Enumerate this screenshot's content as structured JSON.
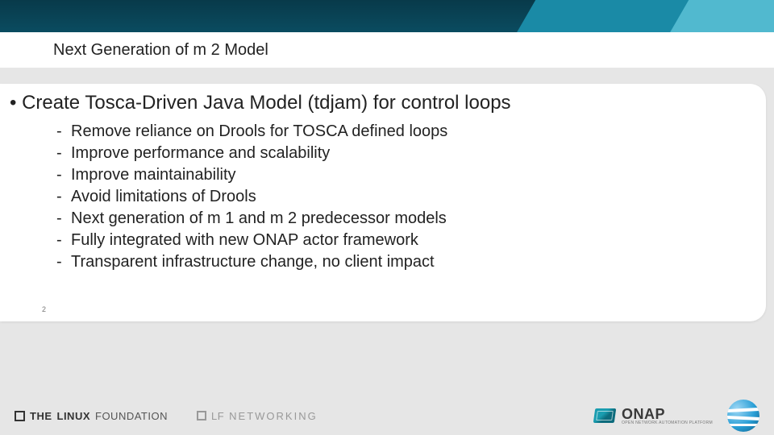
{
  "header": {
    "title": "Next Generation of m 2 Model"
  },
  "content": {
    "main_bullet": "Create Tosca-Driven Java Model (tdjam) for control loops",
    "sub_bullets": [
      "Remove reliance on Drools for TOSCA defined loops",
      "Improve performance and scalability",
      "Improve maintainability",
      "Avoid limitations of Drools",
      "Next generation of m 1 and m 2 predecessor models",
      "Fully integrated with new ONAP actor framework",
      "Transparent infrastructure change, no client impact"
    ]
  },
  "page_number": "2",
  "footer": {
    "linux_foundation_prefix": "THE",
    "linux_foundation_main": "LINUX",
    "linux_foundation_suffix": "FOUNDATION",
    "lfn_prefix": "LF",
    "lfn_suffix": "NETWORKING",
    "onap_name": "ONAP",
    "onap_tag": "OPEN NETWORK AUTOMATION PLATFORM"
  }
}
